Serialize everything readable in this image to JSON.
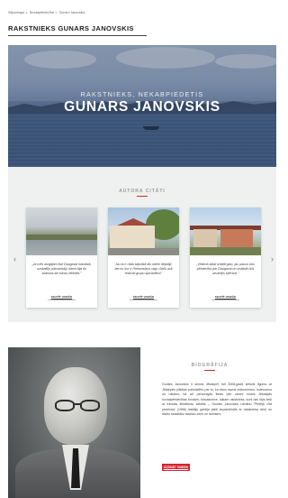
{
  "breadcrumb": {
    "items": [
      "Sākumlapa",
      "Novadpētniecība",
      "Gunars Janovskis"
    ]
  },
  "page_title": "RAKSTNIEKS GUNARS JANOVSKIS",
  "hero": {
    "subtitle": "RAKSTNIEKS, NEKABPIEDETIS",
    "name": "GUNARS JANOVSKIS"
  },
  "quotes": {
    "heading": "AUTORA CITĀTI",
    "items": [
      {
        "photo": "lake-landscape",
        "text": "„Ja mēs aizgājām līdz Daugavai kraslāvā, uzskaitīju pārvarotāju ūdeņi bija tik skaistus kā krastu klēbātīs.”",
        "button": "SKATĪT VAIRĀK"
      },
      {
        "photo": "street-with-houses",
        "text": "„Nu ta ir rāda stiprākā tās ūdeni dejotāji, bet nu kur ir Rietumslavu ragu Obrīk acīt redzoši grupu apmanītos!”",
        "button": "SKATĪT VAIRĀK"
      },
      {
        "photo": "town-buildings",
        "text": "„Vēlāmā atkal izrādīt galu, jau pauzu būs pētniecība par Daugavai un izstāstīt būs uzvarējis šķērsoti.”",
        "button": "SKATĪT VAIRĀK"
      }
    ]
  },
  "biography": {
    "heading": "BIOGRĀFIJA",
    "text": "Gunārs Janovskis ir dzimis Jēkabpilī, bet 2008.gadā slēdzis līgumu ar Jēkabpils pilsētas pašvaldību par to, ka visus savus dokumentus, izdevumus un rakstus, kā arī personīgās lietas pēc nāves nodos Jēkabpils novadpētniecības fondam. Novadniece, laikam rakstnieks, kurš nav bijis tieši ar trimdas literatūras saistīts – Gunārs Janovskis romānu ‘Pēdējā vīra piezīmes’ (1956) lasītāju gaidīja plaši iepazīstināts ar rakstnieka dzīvi un darbu skaistāko latvisko zemi un dzimteni.",
    "button": "UZZINĀT VAIRĀK"
  },
  "colors": {
    "accent": "#d9232d",
    "quotes_bg": "#eef1ef"
  }
}
